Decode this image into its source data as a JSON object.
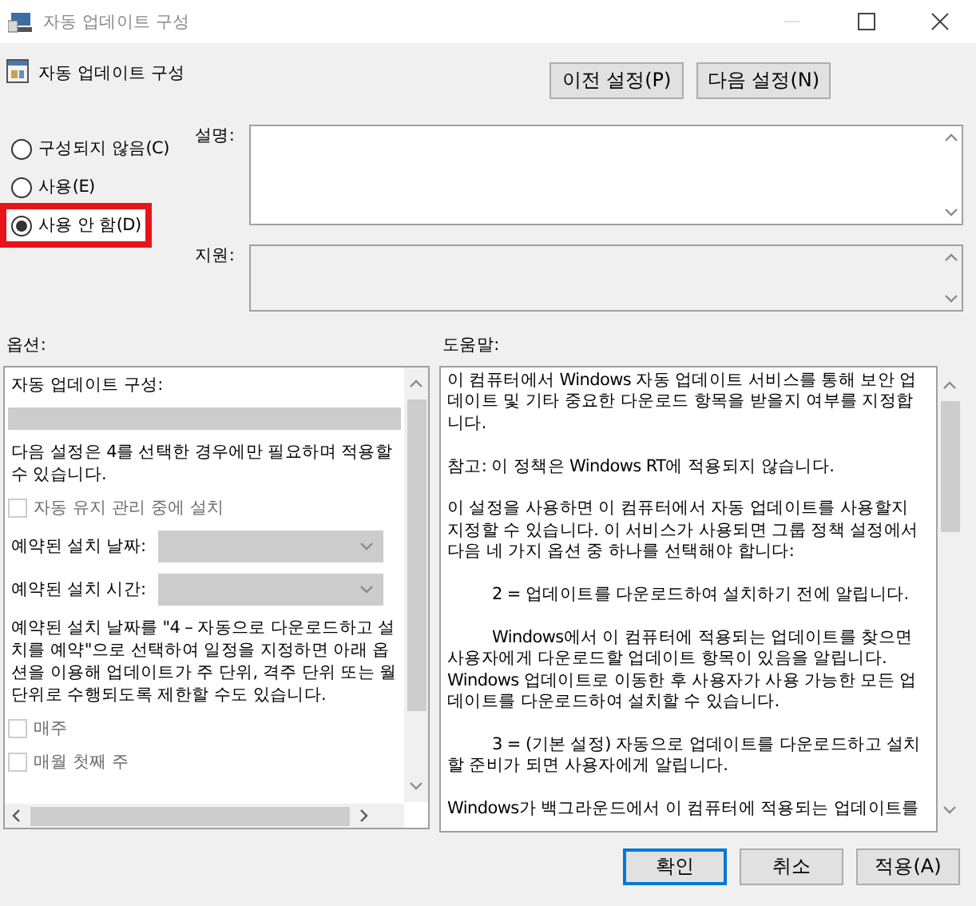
{
  "window": {
    "title": "자동 업데이트 구성"
  },
  "setting_title": "자동 업데이트 구성",
  "nav_buttons": [
    "이전 설정(P)",
    "다음 설정(N)"
  ],
  "state_options": [
    {
      "label": "구성되지 않음(C)",
      "selected": false,
      "highlighted": false
    },
    {
      "label": "사용(E)",
      "selected": false,
      "highlighted": false
    },
    {
      "label": "사용 안 함(D)",
      "selected": true,
      "highlighted": true
    }
  ],
  "comment": {
    "label": "설명:"
  },
  "supported_on": {
    "label": "지원:"
  },
  "options": {
    "label": "옵션:",
    "items": [
      {
        "kind": "text",
        "text": "자동 업데이트 구성:"
      },
      {
        "kind": "dropdown",
        "disabled": true
      },
      {
        "kind": "text",
        "text": "다음 설정은 4를 선택한 경우에만 필요하며 적용할 수 있습니다."
      },
      {
        "kind": "checkbox",
        "text": "자동 유지 관리 중에 설치",
        "checked": false,
        "disabled": true
      },
      {
        "kind": "labeled_dropdown",
        "text": "예약된 설치 날짜:",
        "disabled": true
      },
      {
        "kind": "labeled_dropdown",
        "text": "예약된 설치 시간:",
        "disabled": true
      },
      {
        "kind": "text",
        "text": "예약된 설치 날짜를 \"4 – 자동으로 다운로드하고 설치를 예약\"으로 선택하여 일정을 지정하면 아래 옵션을 이용해 업데이트가 주 단위, 격주 단위 또는 월 단위로 수행되도록 제한할 수도 있습니다."
      },
      {
        "kind": "checkbox",
        "text": "매주",
        "checked": false,
        "disabled": true
      },
      {
        "kind": "checkbox",
        "text": "매월 첫째 주",
        "checked": false,
        "disabled": true
      }
    ]
  },
  "help": {
    "label": "도움말:",
    "paragraphs": [
      {
        "kind": "plain",
        "text": "이 컴퓨터에서 Windows 자동 업데이트 서비스를 통해 보안 업데이트 및 기타 중요한 다운로드 항목을 받을지 여부를 지정합니다."
      },
      {
        "kind": "plain",
        "text": "참고: 이 정책은 Windows RT에 적용되지 않습니다."
      },
      {
        "kind": "plain",
        "text": "이 설정을 사용하면 이 컴퓨터에서 자동 업데이트를 사용할지 지정할 수 있습니다. 이 서비스가 사용되면 그룹 정책 설정에서 다음 네 가지 옵션 중 하나를 선택해야 합니다:"
      },
      {
        "kind": "indented",
        "text": "2 = 업데이트를 다운로드하여 설치하기 전에 알립니다."
      },
      {
        "kind": "indented",
        "text": "Windows에서 이 컴퓨터에 적용되는 업데이트를 찾으면 사용자에게 다운로드할 업데이트 항목이 있음을 알립니다. Windows 업데이트로 이동한 후 사용자가 사용 가능한 모든 업데이트를 다운로드하여 설치할 수 있습니다."
      },
      {
        "kind": "indented",
        "text": "3 = (기본 설정) 자동으로 업데이트를 다운로드하고 설치할 준비가 되면 사용자에게 알립니다."
      },
      {
        "kind": "plain",
        "text": "Windows가 백그라운드에서 이 컴퓨터에 적용되는 업데이트를"
      }
    ]
  },
  "dialog_buttons": [
    {
      "label": "확인",
      "default": true
    },
    {
      "label": "취소",
      "default": false
    },
    {
      "label": "적용(A)",
      "default": false
    }
  ]
}
